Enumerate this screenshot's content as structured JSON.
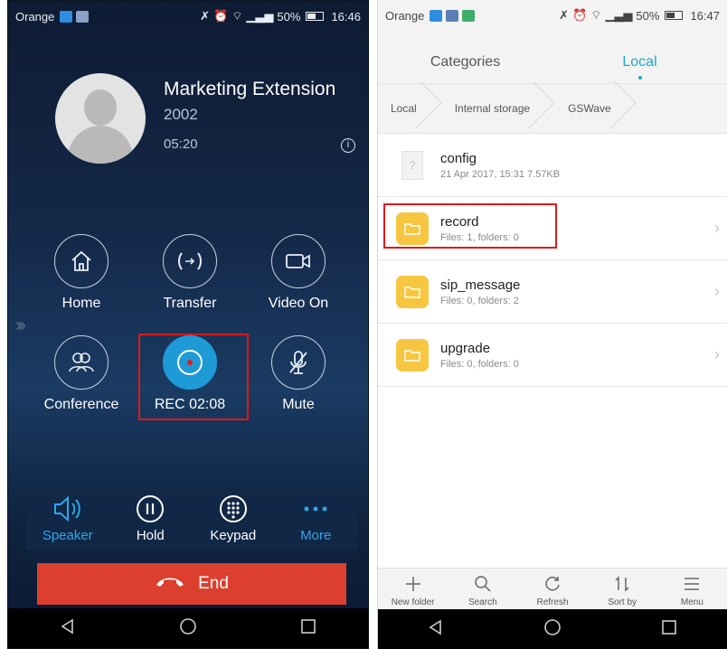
{
  "left": {
    "status": {
      "carrier": "Orange",
      "battery": "50%",
      "time": "16:46"
    },
    "callee": {
      "name": "Marketing Extension",
      "extension": "2002",
      "duration": "05:20"
    },
    "actions": {
      "home": "Home",
      "transfer": "Transfer",
      "video": "Video On",
      "conference": "Conference",
      "rec": "REC 02:08",
      "mute": "Mute"
    },
    "controls": {
      "speaker": "Speaker",
      "hold": "Hold",
      "keypad": "Keypad",
      "more": "More"
    },
    "end": "End"
  },
  "right": {
    "status": {
      "carrier": "Orange",
      "battery": "50%",
      "time": "16:47"
    },
    "tabs": [
      "Categories",
      "Local"
    ],
    "active_tab": "Local",
    "breadcrumb": [
      "Local",
      "Internal storage",
      "GSWave"
    ],
    "files": [
      {
        "name": "config",
        "sub": "21 Apr 2017, 15:31 7.57KB",
        "type": "file"
      },
      {
        "name": "record",
        "sub": "Files: 1, folders: 0",
        "type": "folder"
      },
      {
        "name": "sip_message",
        "sub": "Files: 0, folders: 2",
        "type": "folder"
      },
      {
        "name": "upgrade",
        "sub": "Files: 0, folders: 0",
        "type": "folder"
      }
    ],
    "toolbar": [
      "New folder",
      "Search",
      "Refresh",
      "Sort by",
      "Menu"
    ]
  },
  "colors": {
    "accent_blue": "#1e9ad6",
    "end_red": "#dc3f2d",
    "highlight_red": "#e01818",
    "folder_yellow": "#f7c640",
    "tab_active": "#1ba9c6"
  }
}
